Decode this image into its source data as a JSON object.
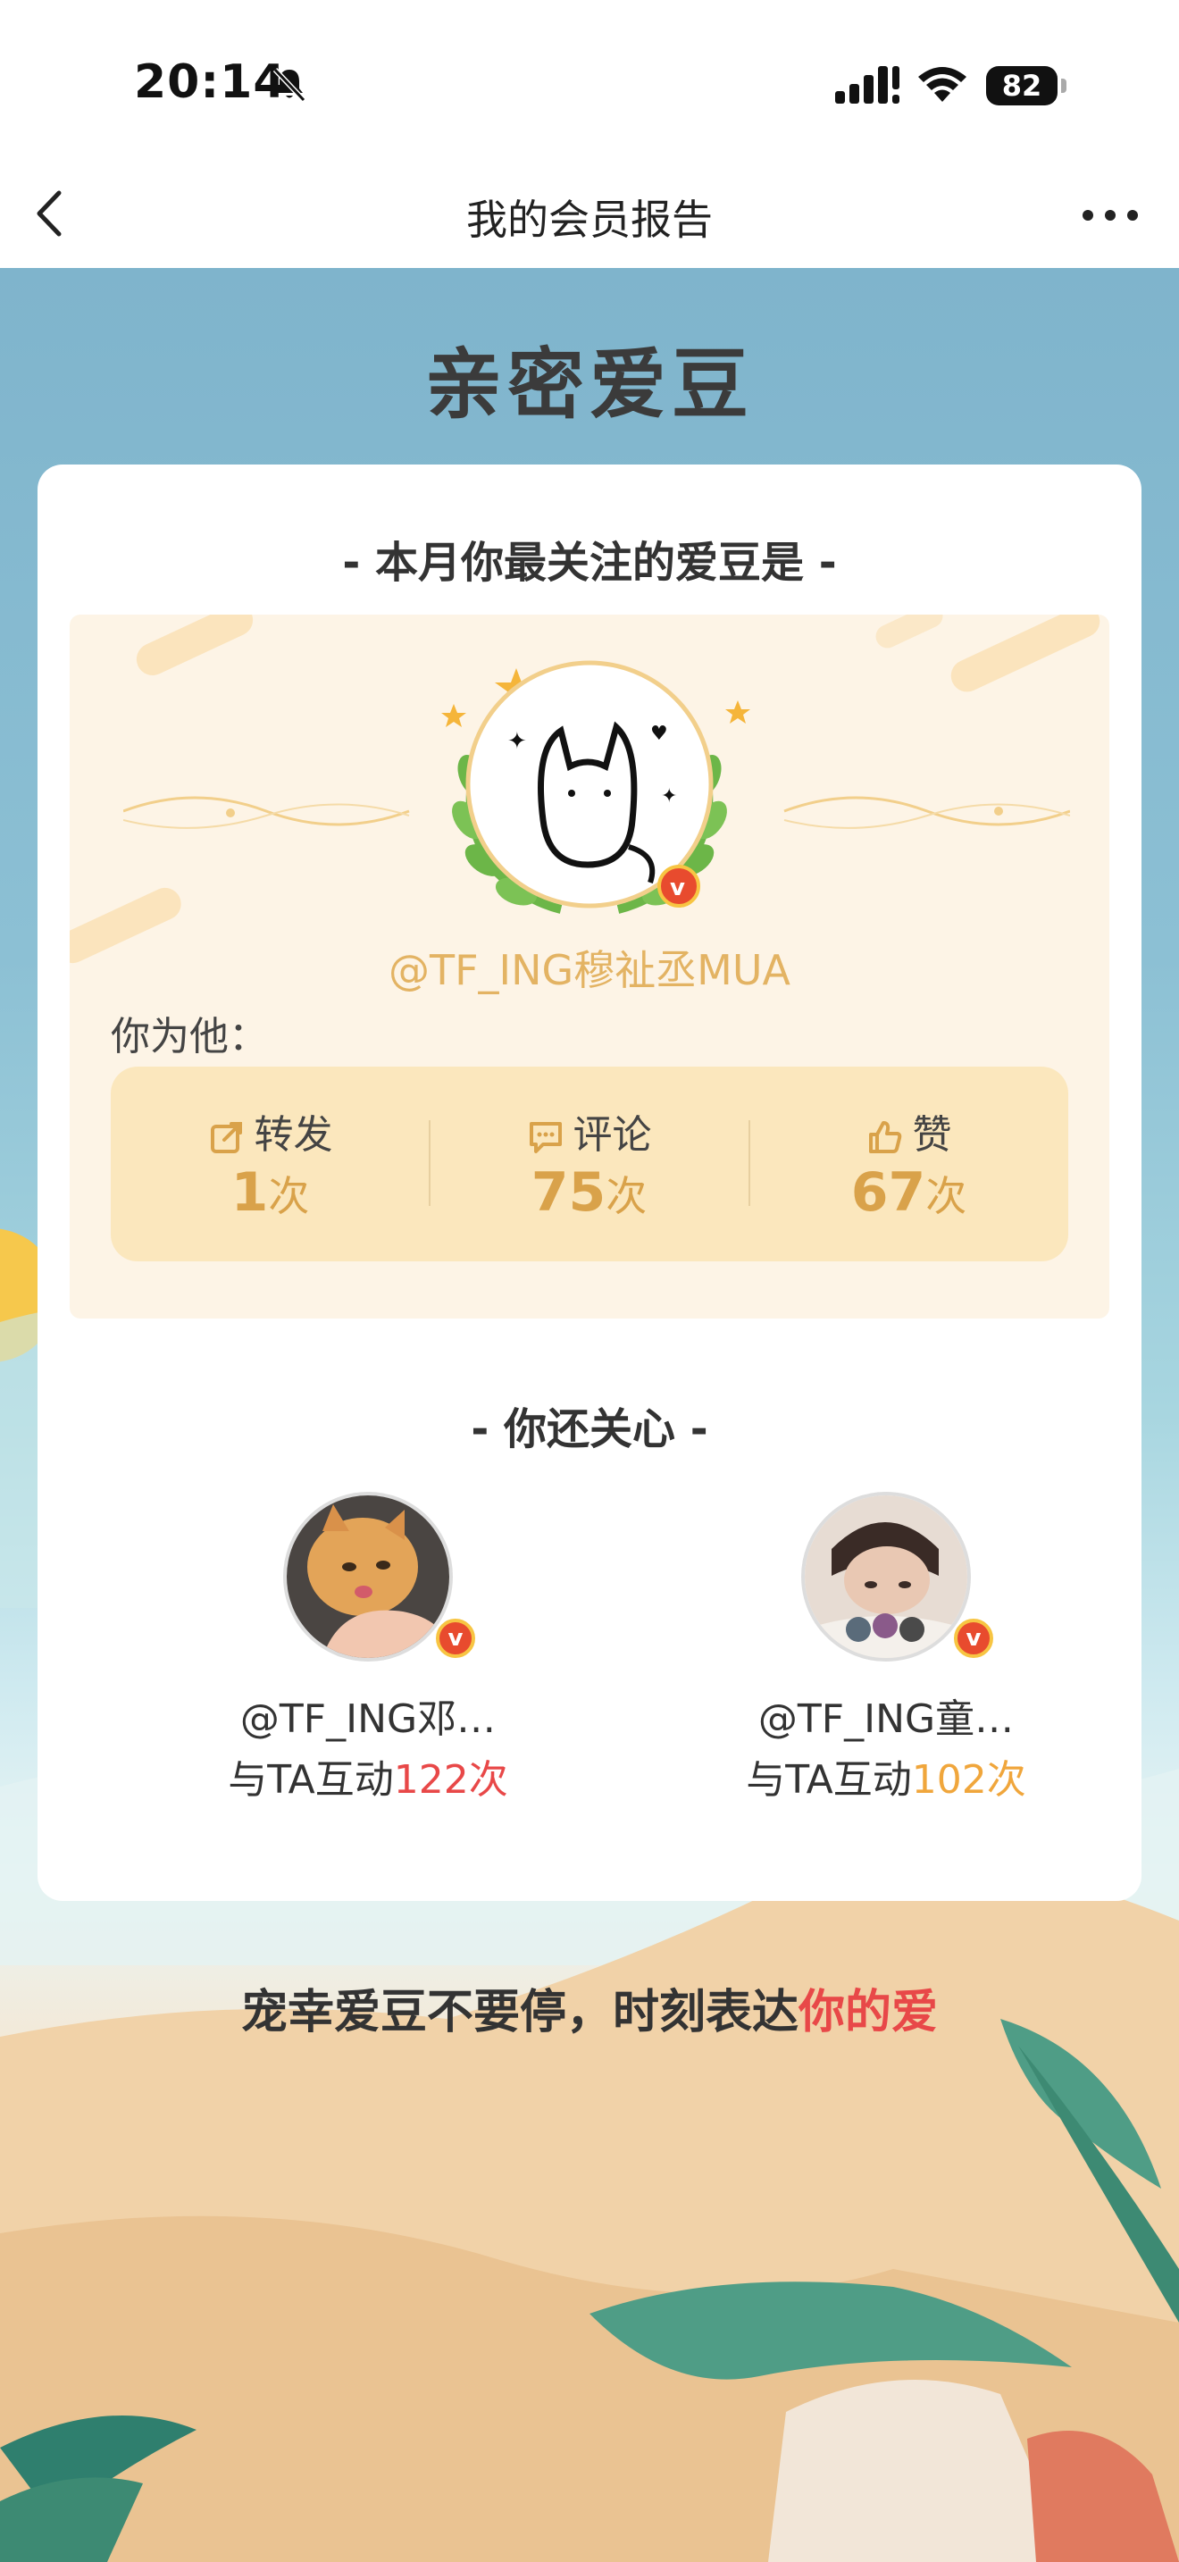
{
  "status": {
    "time": "20:14",
    "battery": "82"
  },
  "nav": {
    "title": "我的会员报告"
  },
  "heading": "亲密爱豆",
  "card": {
    "top_title": "- 本月你最关注的爱豆是 -",
    "idol_name": "@TF_ING穆祉丞MUA",
    "for_him": "你为他：",
    "stats": [
      {
        "label": "转发",
        "value": "1",
        "unit": "次",
        "icon": "share-icon"
      },
      {
        "label": "评论",
        "value": "75",
        "unit": "次",
        "icon": "comment-icon"
      },
      {
        "label": "赞",
        "value": "67",
        "unit": "次",
        "icon": "like-icon"
      }
    ],
    "also_title": "- 你还关心 -",
    "also": [
      {
        "name": "@TF_ING邓…",
        "prefix": "与TA互动",
        "count": "122次",
        "count_color": "#e84848"
      },
      {
        "name": "@TF_ING童…",
        "prefix": "与TA互动",
        "count": "102次",
        "count_color": "#f0a63c"
      }
    ]
  },
  "slogan": {
    "main": "宠幸爱豆不要停，时刻表达",
    "highlight": "你的爱"
  },
  "colors": {
    "accent_red": "#e84848",
    "gold": "#d9a24a",
    "panel": "#fdf4e6"
  }
}
